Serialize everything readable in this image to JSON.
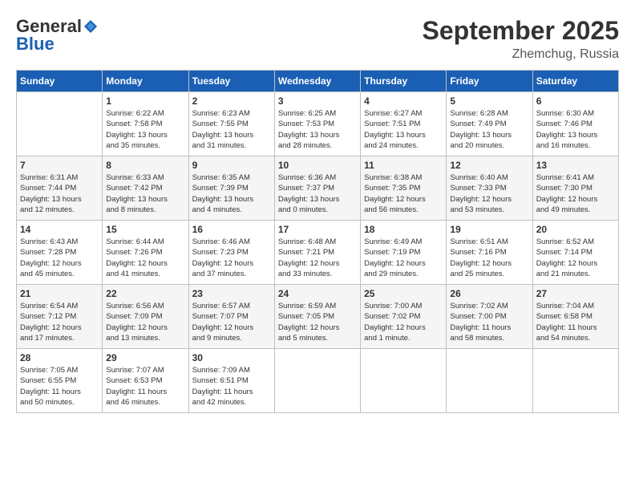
{
  "header": {
    "logo_general": "General",
    "logo_blue": "Blue",
    "month": "September 2025",
    "location": "Zhemchug, Russia"
  },
  "weekdays": [
    "Sunday",
    "Monday",
    "Tuesday",
    "Wednesday",
    "Thursday",
    "Friday",
    "Saturday"
  ],
  "weeks": [
    [
      {
        "day": "",
        "content": ""
      },
      {
        "day": "1",
        "content": "Sunrise: 6:22 AM\nSunset: 7:58 PM\nDaylight: 13 hours\nand 35 minutes."
      },
      {
        "day": "2",
        "content": "Sunrise: 6:23 AM\nSunset: 7:55 PM\nDaylight: 13 hours\nand 31 minutes."
      },
      {
        "day": "3",
        "content": "Sunrise: 6:25 AM\nSunset: 7:53 PM\nDaylight: 13 hours\nand 28 minutes."
      },
      {
        "day": "4",
        "content": "Sunrise: 6:27 AM\nSunset: 7:51 PM\nDaylight: 13 hours\nand 24 minutes."
      },
      {
        "day": "5",
        "content": "Sunrise: 6:28 AM\nSunset: 7:49 PM\nDaylight: 13 hours\nand 20 minutes."
      },
      {
        "day": "6",
        "content": "Sunrise: 6:30 AM\nSunset: 7:46 PM\nDaylight: 13 hours\nand 16 minutes."
      }
    ],
    [
      {
        "day": "7",
        "content": "Sunrise: 6:31 AM\nSunset: 7:44 PM\nDaylight: 13 hours\nand 12 minutes."
      },
      {
        "day": "8",
        "content": "Sunrise: 6:33 AM\nSunset: 7:42 PM\nDaylight: 13 hours\nand 8 minutes."
      },
      {
        "day": "9",
        "content": "Sunrise: 6:35 AM\nSunset: 7:39 PM\nDaylight: 13 hours\nand 4 minutes."
      },
      {
        "day": "10",
        "content": "Sunrise: 6:36 AM\nSunset: 7:37 PM\nDaylight: 13 hours\nand 0 minutes."
      },
      {
        "day": "11",
        "content": "Sunrise: 6:38 AM\nSunset: 7:35 PM\nDaylight: 12 hours\nand 56 minutes."
      },
      {
        "day": "12",
        "content": "Sunrise: 6:40 AM\nSunset: 7:33 PM\nDaylight: 12 hours\nand 53 minutes."
      },
      {
        "day": "13",
        "content": "Sunrise: 6:41 AM\nSunset: 7:30 PM\nDaylight: 12 hours\nand 49 minutes."
      }
    ],
    [
      {
        "day": "14",
        "content": "Sunrise: 6:43 AM\nSunset: 7:28 PM\nDaylight: 12 hours\nand 45 minutes."
      },
      {
        "day": "15",
        "content": "Sunrise: 6:44 AM\nSunset: 7:26 PM\nDaylight: 12 hours\nand 41 minutes."
      },
      {
        "day": "16",
        "content": "Sunrise: 6:46 AM\nSunset: 7:23 PM\nDaylight: 12 hours\nand 37 minutes."
      },
      {
        "day": "17",
        "content": "Sunrise: 6:48 AM\nSunset: 7:21 PM\nDaylight: 12 hours\nand 33 minutes."
      },
      {
        "day": "18",
        "content": "Sunrise: 6:49 AM\nSunset: 7:19 PM\nDaylight: 12 hours\nand 29 minutes."
      },
      {
        "day": "19",
        "content": "Sunrise: 6:51 AM\nSunset: 7:16 PM\nDaylight: 12 hours\nand 25 minutes."
      },
      {
        "day": "20",
        "content": "Sunrise: 6:52 AM\nSunset: 7:14 PM\nDaylight: 12 hours\nand 21 minutes."
      }
    ],
    [
      {
        "day": "21",
        "content": "Sunrise: 6:54 AM\nSunset: 7:12 PM\nDaylight: 12 hours\nand 17 minutes."
      },
      {
        "day": "22",
        "content": "Sunrise: 6:56 AM\nSunset: 7:09 PM\nDaylight: 12 hours\nand 13 minutes."
      },
      {
        "day": "23",
        "content": "Sunrise: 6:57 AM\nSunset: 7:07 PM\nDaylight: 12 hours\nand 9 minutes."
      },
      {
        "day": "24",
        "content": "Sunrise: 6:59 AM\nSunset: 7:05 PM\nDaylight: 12 hours\nand 5 minutes."
      },
      {
        "day": "25",
        "content": "Sunrise: 7:00 AM\nSunset: 7:02 PM\nDaylight: 12 hours\nand 1 minute."
      },
      {
        "day": "26",
        "content": "Sunrise: 7:02 AM\nSunset: 7:00 PM\nDaylight: 11 hours\nand 58 minutes."
      },
      {
        "day": "27",
        "content": "Sunrise: 7:04 AM\nSunset: 6:58 PM\nDaylight: 11 hours\nand 54 minutes."
      }
    ],
    [
      {
        "day": "28",
        "content": "Sunrise: 7:05 AM\nSunset: 6:55 PM\nDaylight: 11 hours\nand 50 minutes."
      },
      {
        "day": "29",
        "content": "Sunrise: 7:07 AM\nSunset: 6:53 PM\nDaylight: 11 hours\nand 46 minutes."
      },
      {
        "day": "30",
        "content": "Sunrise: 7:09 AM\nSunset: 6:51 PM\nDaylight: 11 hours\nand 42 minutes."
      },
      {
        "day": "",
        "content": ""
      },
      {
        "day": "",
        "content": ""
      },
      {
        "day": "",
        "content": ""
      },
      {
        "day": "",
        "content": ""
      }
    ]
  ]
}
